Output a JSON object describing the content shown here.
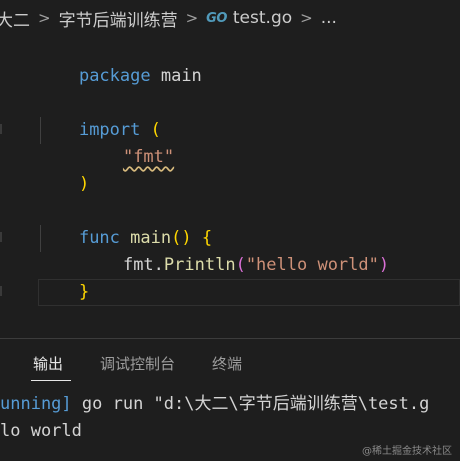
{
  "breadcrumb": {
    "segments": [
      "大二",
      "字节后端训练营"
    ],
    "go_icon_text": "GO",
    "file": "test.go",
    "ellipsis": "..."
  },
  "editor": {
    "lines": {
      "l1": {
        "kw": "package",
        "rest": " main"
      },
      "l3": {
        "kw": "import",
        "space": " ",
        "paren": "("
      },
      "l4": {
        "str": "\"fmt\""
      },
      "l5": {
        "paren": ")"
      },
      "l7": {
        "kw": "func",
        "space": " ",
        "fn": "main",
        "parens": "()",
        "space2": " ",
        "brace": "{"
      },
      "l8": {
        "pkg": "fmt.",
        "fn": "Println",
        "open": "(",
        "str": "\"hello world\"",
        "close": ")"
      },
      "l9": {
        "brace": "}"
      }
    }
  },
  "panel": {
    "tabs": [
      {
        "label": "输出"
      },
      {
        "label": "调试控制台"
      },
      {
        "label": "终端"
      }
    ],
    "output": {
      "line1_blue": "unning]",
      "line1_rest": " go run \"d:\\大二\\字节后端训练营\\test.g",
      "line2": "lo world"
    }
  },
  "watermark": "@稀土掘金技术社区",
  "colors": {
    "background": "#1e1e1e",
    "keyword": "#569cd6",
    "function": "#dcdcaa",
    "string": "#ce9178",
    "bracket_yellow": "#ffd700",
    "bracket_purple": "#da70d6"
  }
}
